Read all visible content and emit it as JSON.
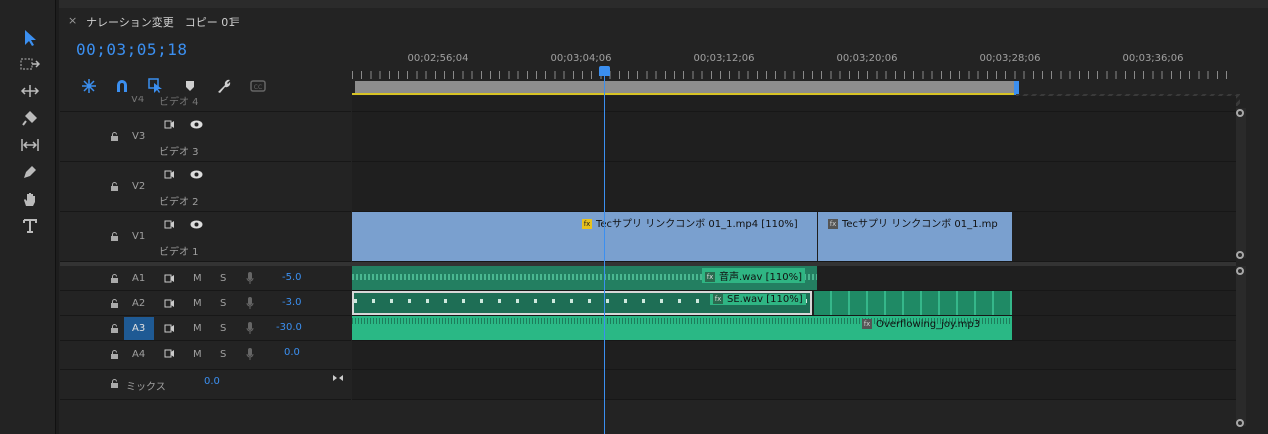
{
  "sequence": {
    "tab_close": "×",
    "tab_title": "ナレーション変更　コピー 01",
    "tab_menu": "≡",
    "timecode": "00;03;05;18"
  },
  "ruler": {
    "labels": [
      "00;02;56;04",
      "00;03;04;06",
      "00;03;12;06",
      "00;03;20;06",
      "00;03;28;06",
      "00;03;36;06"
    ]
  },
  "video_tracks": [
    {
      "id": "V4",
      "name": "ビデオ 4"
    },
    {
      "id": "V3",
      "name": "ビデオ 3"
    },
    {
      "id": "V2",
      "name": "ビデオ 2"
    },
    {
      "id": "V1",
      "name": "ビデオ 1"
    }
  ],
  "audio_tracks": [
    {
      "id": "A1",
      "m": "M",
      "s": "S",
      "volume": "-5.0"
    },
    {
      "id": "A2",
      "m": "M",
      "s": "S",
      "volume": "-3.0"
    },
    {
      "id": "A3",
      "m": "M",
      "s": "S",
      "volume": "-30.0"
    },
    {
      "id": "A4",
      "m": "M",
      "s": "S",
      "volume": "0.0"
    }
  ],
  "mix": {
    "label": "ミックス",
    "value": "0.0"
  },
  "clips": {
    "v1_a": "Tecサプリ リンクコンボ 01_1.mp4 [110%]",
    "v1_b": "Tecサプリ リンクコンボ 01_1.mp",
    "a1": "音声.wav [110%]",
    "a2": "SE.wav [110%]",
    "a3": "Overflowing_joy.mp3"
  },
  "fx_label": "fx",
  "colors": {
    "accent": "#3b8ff0",
    "video_clip": "#7aa0cf",
    "audio_clip": "#27a17b",
    "work_line": "#d8c324"
  }
}
